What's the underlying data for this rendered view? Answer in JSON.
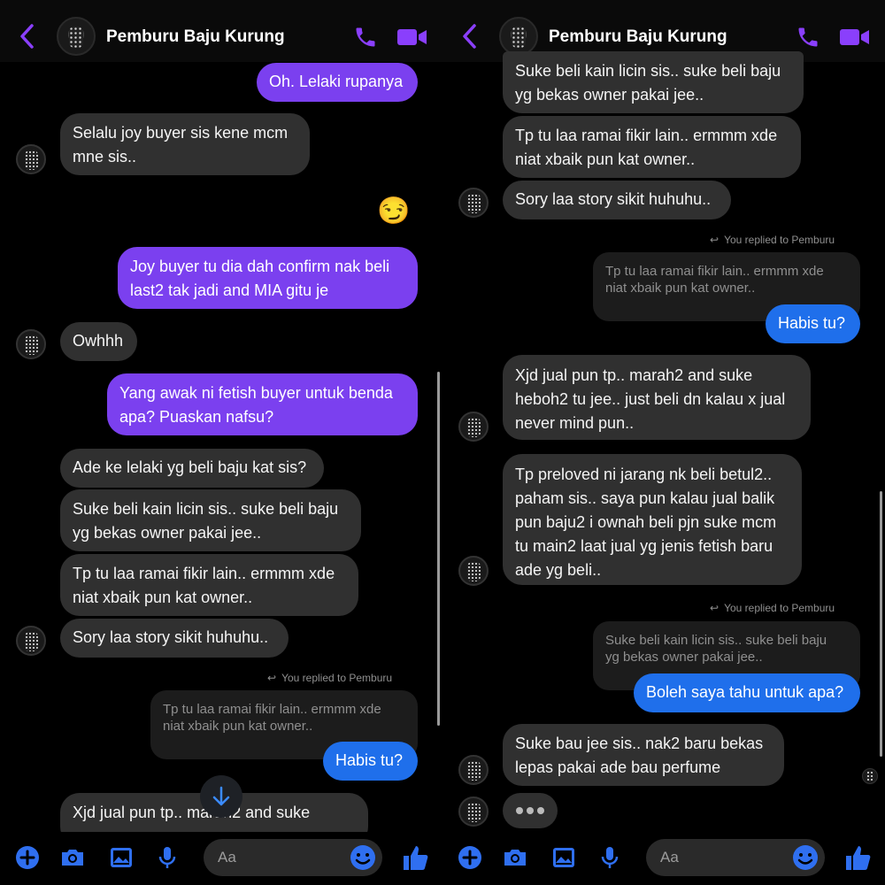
{
  "contact_name": "Pemburu Baju Kurung",
  "composer_placeholder": "Aa",
  "reply_note": "You replied to Pemburu",
  "colors": {
    "accent": "#7b40ef",
    "blue": "#1f6feb",
    "incoming": "#303030",
    "icon": "#8a3ffc"
  },
  "left": {
    "m1": "Oh. Lelaki rupanya",
    "m2a": "Selalu joy buyer sis kene mcm",
    "m2b": "mne sis..",
    "emoji": "😏",
    "m3a": "Joy buyer tu dia dah confirm nak beli",
    "m3b": "last2 tak jadi and MIA gitu je",
    "m4": "Owhhh",
    "m5a": "Yang awak ni fetish buyer untuk benda",
    "m5b": "apa? Puaskan nafsu?",
    "m6": "Ade ke lelaki yg beli baju kat sis?",
    "m7a": "Suke beli kain licin sis.. suke beli baju",
    "m7b": "yg bekas owner pakai jee..",
    "m8a": "Tp tu laa ramai fikir lain.. ermmm xde",
    "m8b": "niat xbaik pun kat owner..",
    "m9": "Sory laa story sikit huhuhu..",
    "q1a": "Tp tu laa ramai fikir lain.. ermmm xde",
    "q1b": "niat xbaik pun kat owner..",
    "m10": "Habis tu?",
    "m11": "Xjd jual pun tp.. marah2 and suke"
  },
  "right": {
    "m1a": "Suke beli kain licin sis.. suke beli baju",
    "m1b": "yg bekas owner pakai jee..",
    "m2a": "Tp tu laa ramai fikir lain.. ermmm xde",
    "m2b": "niat xbaik pun kat owner..",
    "m3": "Sory laa story sikit huhuhu..",
    "q1a": "Tp tu laa ramai fikir lain.. ermmm xde",
    "q1b": "niat xbaik pun kat owner..",
    "m4": "Habis tu?",
    "m5a": "Xjd jual pun tp.. marah2 and suke",
    "m5b": "heboh2 tu jee.. just beli dn kalau x jual",
    "m5c": "never mind pun..",
    "m6a": "Tp preloved ni jarang nk beli betul2..",
    "m6b": "paham sis.. saya pun kalau jual balik",
    "m6c": "pun baju2 i ownah beli pjn suke mcm",
    "m6d": "tu main2 laat jual yg jenis fetish baru",
    "m6e": "ade yg beli..",
    "q2a": "Suke beli kain licin sis.. suke beli baju",
    "q2b": "yg bekas owner pakai jee..",
    "m7": "Boleh saya tahu untuk apa?",
    "m8a": "Suke bau jee sis.. nak2 baru bekas",
    "m8b": "lepas pakai ade bau perfume"
  }
}
